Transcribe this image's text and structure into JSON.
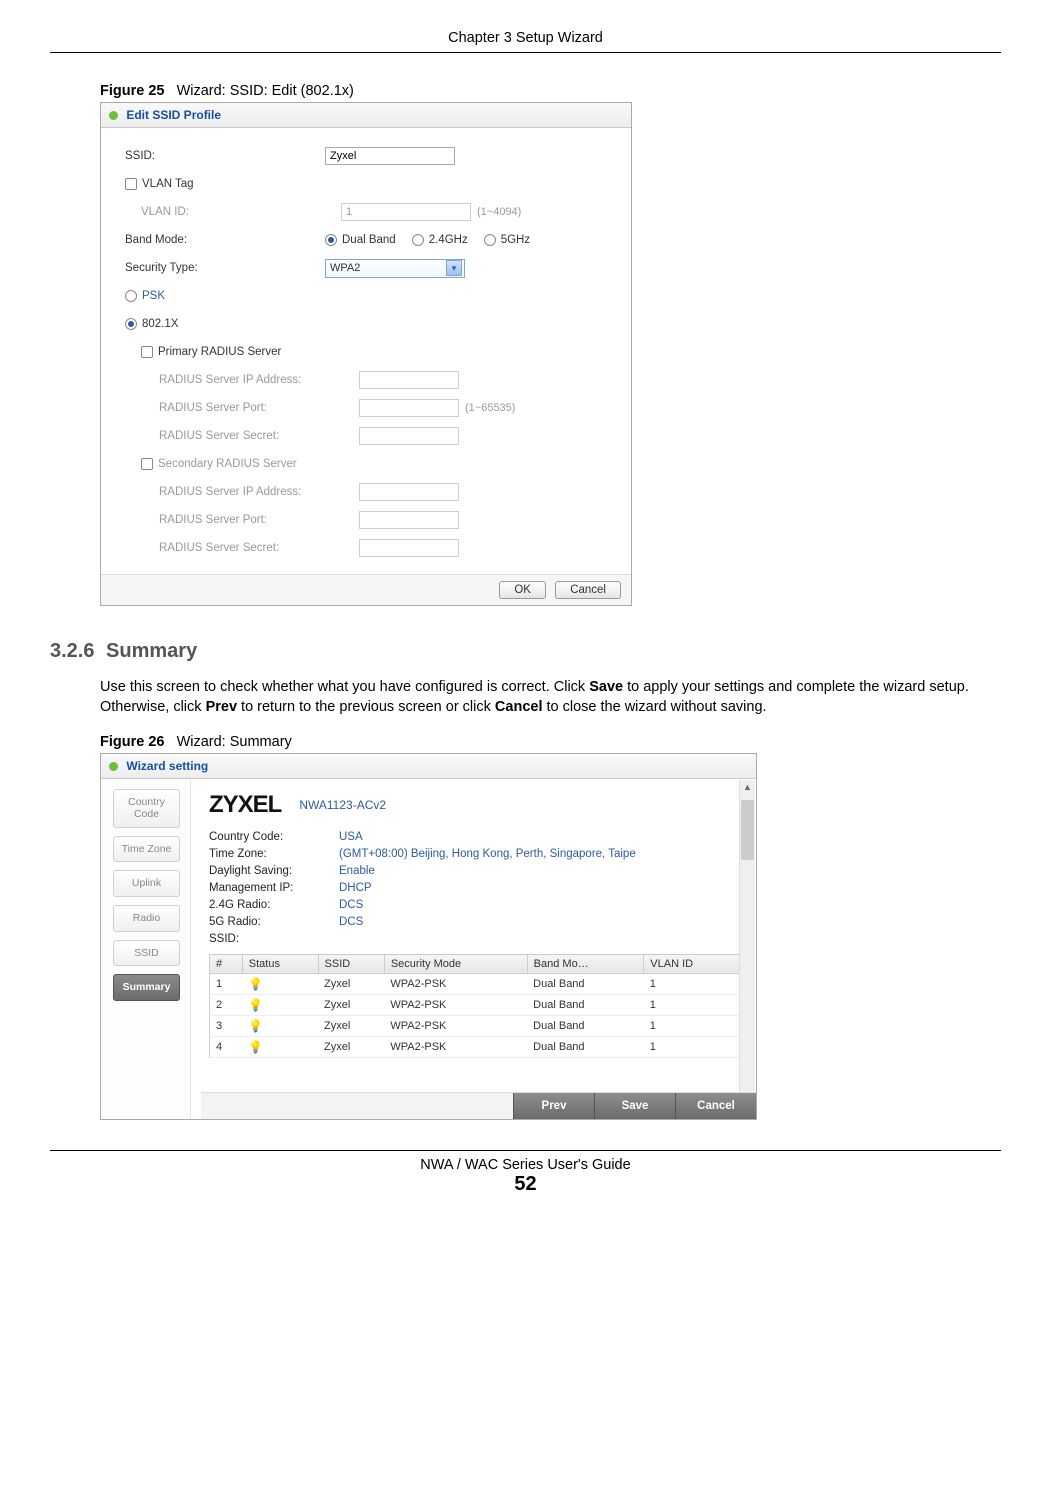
{
  "chapter_header": "Chapter 3 Setup Wizard",
  "fig25": {
    "caption_num": "Figure 25",
    "caption_text": "Wizard: SSID: Edit (802.1x)",
    "title": "Edit SSID Profile",
    "fields": {
      "ssid_label": "SSID:",
      "ssid_value": "Zyxel",
      "vlan_tag_label": "VLAN Tag",
      "vlan_id_label": "VLAN ID:",
      "vlan_id_value": "1",
      "vlan_id_hint": "(1~4094)",
      "band_mode_label": "Band Mode:",
      "band_dual": "Dual Band",
      "band_24": "2.4GHz",
      "band_5": "5GHz",
      "sec_type_label": "Security Type:",
      "sec_type_value": "WPA2",
      "psk_label": "PSK",
      "dot1x_label": "802.1X",
      "primary_radius_label": "Primary RADIUS Server",
      "radius_ip_label": "RADIUS Server IP Address:",
      "radius_port_label": "RADIUS Server Port:",
      "radius_port_hint": "(1~65535)",
      "radius_secret_label": "RADIUS Server Secret:",
      "secondary_radius_label": "Secondary RADIUS Server"
    },
    "ok": "OK",
    "cancel": "Cancel"
  },
  "section": {
    "num": "3.2.6",
    "title": "Summary",
    "para_a": "Use this screen to check whether what you have configured is correct. Click ",
    "save": "Save",
    "para_b": " to apply your settings and complete the wizard setup. Otherwise, click ",
    "prev": "Prev",
    "para_c": " to return to the previous screen or click ",
    "cancel": "Cancel",
    "para_d": " to close the wizard without saving."
  },
  "fig26": {
    "caption_num": "Figure 26",
    "caption_text": "Wizard: Summary",
    "title": "Wizard setting",
    "steps": [
      "Country Code",
      "Time Zone",
      "Uplink",
      "Radio",
      "SSID",
      "Summary"
    ],
    "logo": "ZYXEL",
    "model": "NWA1123-ACv2",
    "kv": [
      {
        "k": "Country Code:",
        "v": "USA"
      },
      {
        "k": "Time Zone:",
        "v": "(GMT+08:00) Beijing, Hong Kong, Perth, Singapore, Taipe"
      },
      {
        "k": "Daylight Saving:",
        "v": "Enable"
      },
      {
        "k": "Management IP:",
        "v": "DHCP"
      },
      {
        "k": "2.4G Radio:",
        "v": "DCS"
      },
      {
        "k": "5G Radio:",
        "v": "DCS"
      },
      {
        "k": "SSID:",
        "v": ""
      }
    ],
    "cols": [
      "#",
      "Status",
      "SSID",
      "Security Mode",
      "Band Mo…",
      "VLAN ID"
    ],
    "rows": [
      {
        "n": "1",
        "on": true,
        "ssid": "Zyxel",
        "sec": "WPA2-PSK",
        "band": "Dual Band",
        "vlan": "1"
      },
      {
        "n": "2",
        "on": true,
        "ssid": "Zyxel",
        "sec": "WPA2-PSK",
        "band": "Dual Band",
        "vlan": "1"
      },
      {
        "n": "3",
        "on": true,
        "ssid": "Zyxel",
        "sec": "WPA2-PSK",
        "band": "Dual Band",
        "vlan": "1"
      },
      {
        "n": "4",
        "on": false,
        "ssid": "Zyxel",
        "sec": "WPA2-PSK",
        "band": "Dual Band",
        "vlan": "1"
      }
    ],
    "prev_btn": "Prev",
    "save_btn": "Save",
    "cancel_btn": "Cancel"
  },
  "footer": {
    "guide": "NWA / WAC Series User's Guide",
    "page": "52"
  }
}
